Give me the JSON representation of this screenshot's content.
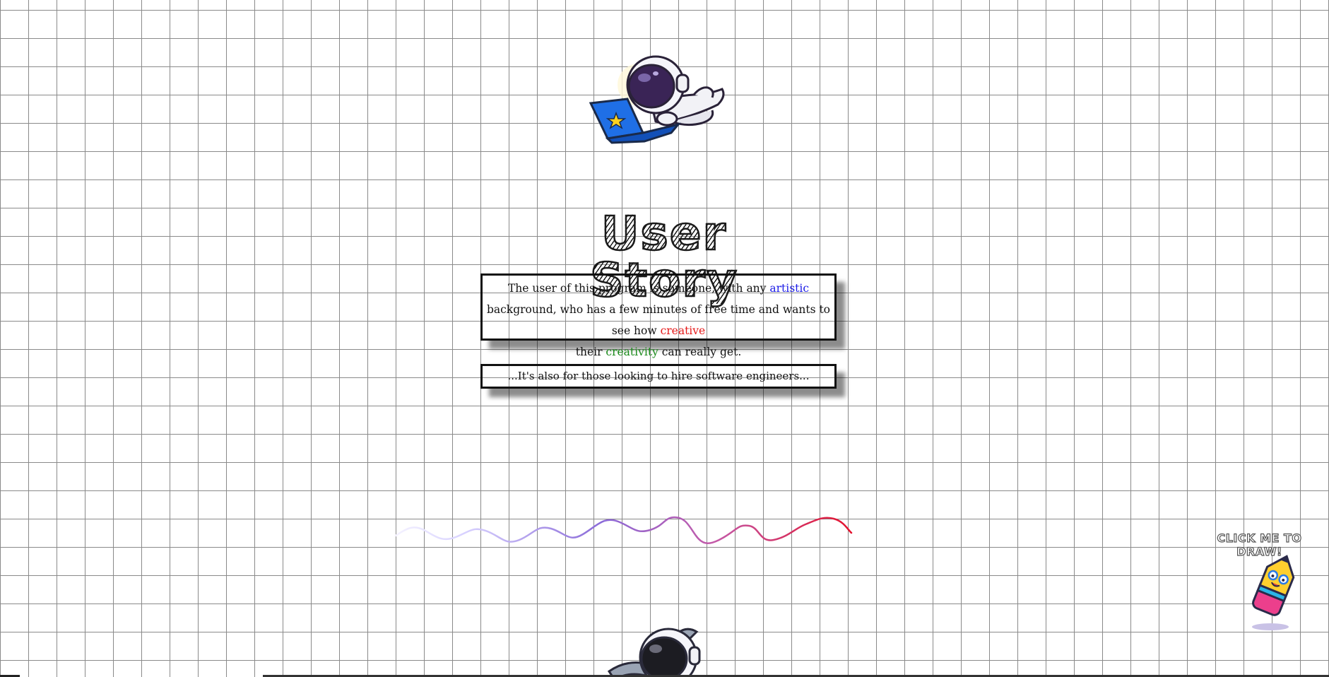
{
  "title": "User Story",
  "story": {
    "part1": "The user of this program is someone, with any ",
    "keyword_artistic": "artistic",
    "part2": " background, who has a few minutes of free time and wants to see how ",
    "keyword_creative": "creative",
    "part3": " their ",
    "keyword_creativity": "creativity",
    "part4": " can really get."
  },
  "hire_note": "...It's also for those looking to hire software engineers...",
  "draw_cta": {
    "label": "CLICK ME TO DRAW!",
    "icon": "pencil-icon"
  },
  "icons": {
    "hero": "astronaut-laptop-icon",
    "bottom": "astronaut-wrench-icon"
  },
  "colors": {
    "artistic": "#1a1ae6",
    "creative": "#e61a1a",
    "creativity": "#1a8a1a",
    "grid": "#8a8a8a",
    "squiggle_start": "#e8e4ff",
    "squiggle_mid": "#9b59d0",
    "squiggle_end": "#e3122d"
  }
}
